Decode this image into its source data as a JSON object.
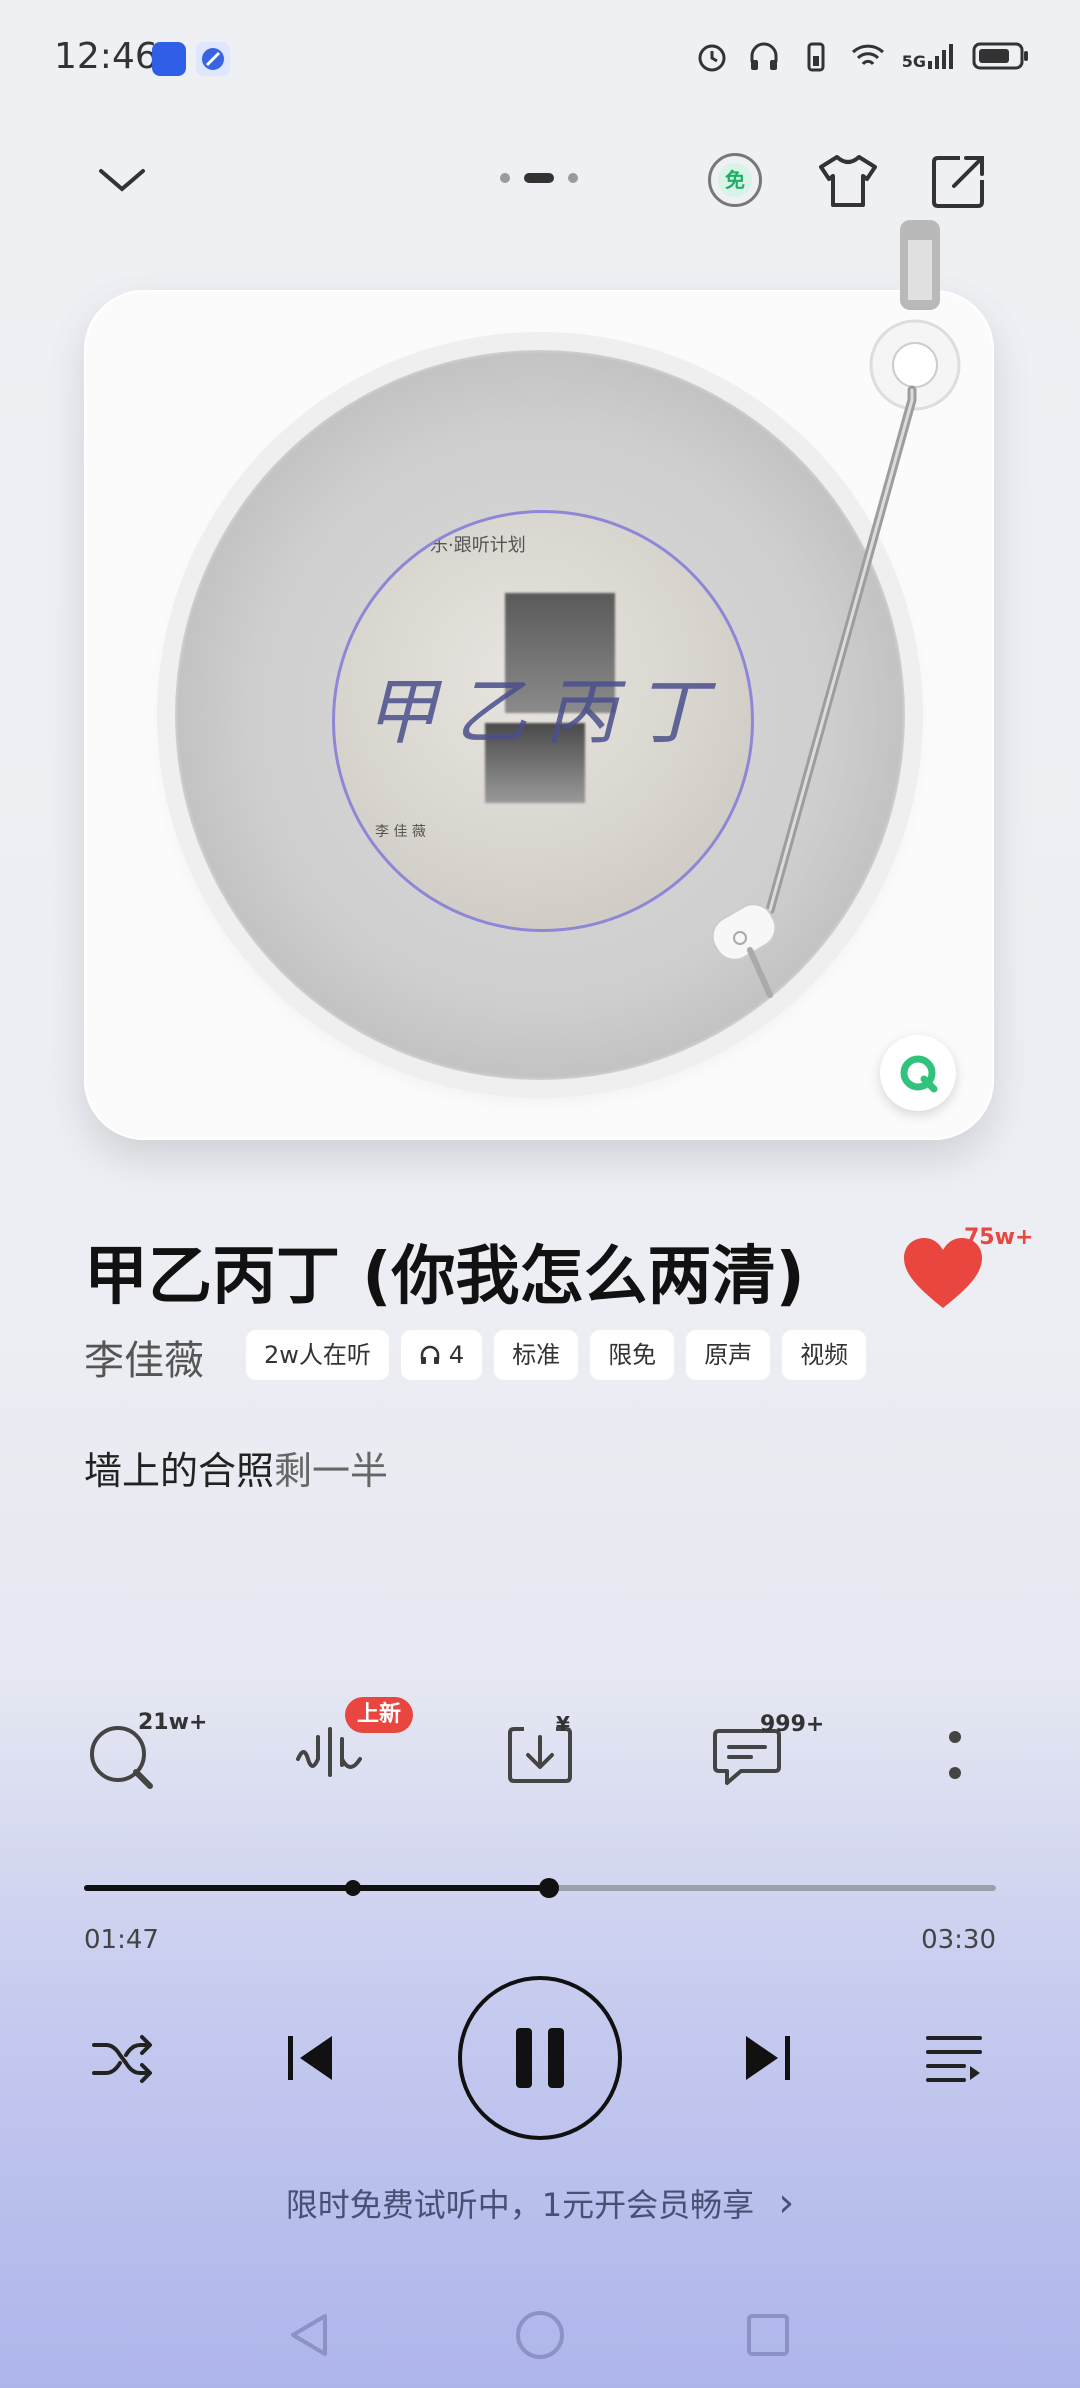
{
  "status_bar": {
    "time": "12:46",
    "network": "5G",
    "icons": [
      "app-icon-blue",
      "app-icon-compass",
      "alarm-icon",
      "headphones-icon",
      "battery-saver-icon",
      "wifi-icon",
      "signal-icon",
      "battery-icon"
    ]
  },
  "top_bar": {
    "collapse_icon": "chevron-down-icon",
    "free_badge": "免",
    "icons": [
      "free-icon",
      "tshirt-icon",
      "share-icon"
    ]
  },
  "player": {
    "label_top": "乐·跟听计划",
    "label_script": "甲乙丙丁",
    "label_bottom": "李 佳 薇",
    "badge_icon": "qq-music-icon"
  },
  "song": {
    "title": "甲乙丙丁 (你我怎么两清)",
    "artist": "李佳薇",
    "like_count": "75w+",
    "tags": [
      "2w人在听",
      "4",
      "标准",
      "限免",
      "原声",
      "视频"
    ]
  },
  "lyric": {
    "highlight": "墙上的合照",
    "rest": "剩一半"
  },
  "actions": {
    "search_count": "21w+",
    "new_label": "上新",
    "download_price": "¥",
    "comment_count": "999+"
  },
  "progress": {
    "current": "01:47",
    "total": "03:30",
    "played_fraction": 0.51,
    "buffer_marker_fraction": 0.295
  },
  "trial": {
    "text": "限时免费试听中，1元开会员畅享",
    "arrow": "›"
  },
  "colors": {
    "accent_red": "#e8463f",
    "qq_green": "#31c27c"
  }
}
